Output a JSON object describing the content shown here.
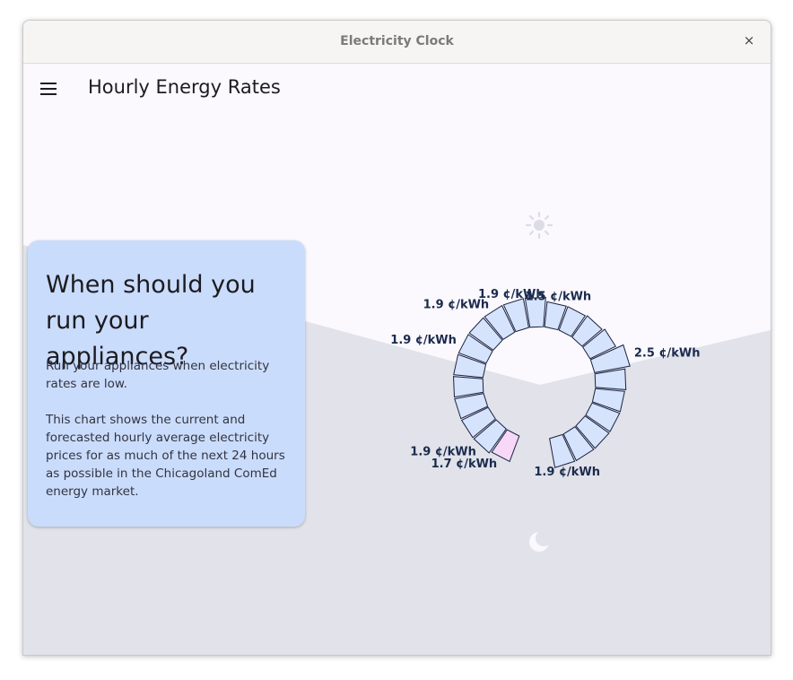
{
  "window": {
    "title": "Electricity Clock",
    "close_glyph": "×"
  },
  "appbar": {
    "title": "Hourly Energy Rates",
    "menu_icon": "menu-icon"
  },
  "card": {
    "heading": "When should you run your appliances?",
    "paragraph1": "Run your appliances when electricity rates are low.",
    "paragraph2": "This chart shows the current and forecasted hourly average electricity prices for as much of the next 24 hours as possible in the Chicagoland ComEd energy market."
  },
  "icons": {
    "top": "sun-icon",
    "bottom": "moon-icon"
  },
  "colors": {
    "segment_fill": "#d6e3fc",
    "current_hour_fill": "#f7d8f8",
    "segment_stroke": "#1a2340",
    "label_color": "#1a2b4d",
    "night_background": "#e1e2ea",
    "day_background": "#fbf8fe",
    "card_background": "#cadcfb"
  },
  "clock": {
    "unit": "¢/kWh",
    "current_hour_index": 0,
    "segments": [
      {
        "value": 1.7,
        "label": "1.7 ¢/kWh"
      },
      {
        "value": 1.9,
        "label": "1.9 ¢/kWh"
      },
      {
        "value": 1.9
      },
      {
        "value": 1.9
      },
      {
        "value": 1.9
      },
      {
        "value": 1.9
      },
      {
        "value": 1.9,
        "label": "1.9 ¢/kWh"
      },
      {
        "value": 1.9
      },
      {
        "value": 1.9,
        "label": "1.9 ¢/kWh"
      },
      {
        "value": 1.9,
        "label": "1.9 ¢/kWh"
      },
      {
        "value": 1.9
      },
      {
        "value": 1.5,
        "label": "1.5 ¢/kWh"
      },
      {
        "value": 1.5
      },
      {
        "value": 1.6
      },
      {
        "value": 1.8
      },
      {
        "value": 2.5,
        "label": "2.5 ¢/kWh"
      },
      {
        "value": 2.0
      },
      {
        "value": 1.9
      },
      {
        "value": 1.9
      },
      {
        "value": 1.9
      },
      {
        "value": 1.9
      },
      {
        "value": 1.9,
        "label": "1.9 ¢/kWh"
      }
    ]
  }
}
